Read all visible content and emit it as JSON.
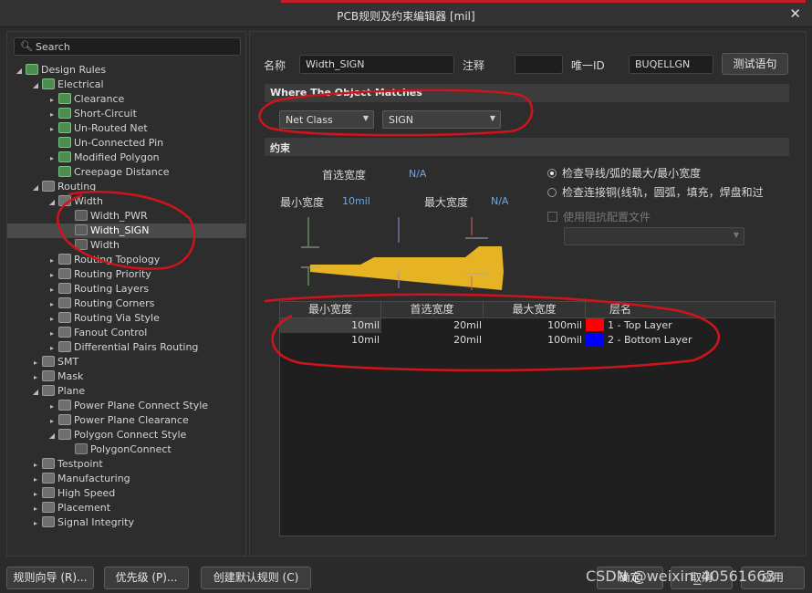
{
  "window": {
    "title": "PCB规则及约束编辑器 [mil]",
    "close": "✕"
  },
  "search": {
    "placeholder": "Search"
  },
  "tree": [
    {
      "label": "Design Rules",
      "level": 0,
      "exp": "◢",
      "icon": "rule"
    },
    {
      "label": "Electrical",
      "level": 1,
      "exp": "◢",
      "icon": "rule"
    },
    {
      "label": "Clearance",
      "level": 2,
      "exp": "▸",
      "icon": "rule"
    },
    {
      "label": "Short-Circuit",
      "level": 2,
      "exp": "▸",
      "icon": "rule"
    },
    {
      "label": "Un-Routed Net",
      "level": 2,
      "exp": "▸",
      "icon": "rule"
    },
    {
      "label": "Un-Connected Pin",
      "level": 2,
      "exp": "",
      "icon": "rule"
    },
    {
      "label": "Modified Polygon",
      "level": 2,
      "exp": "▸",
      "icon": "rule"
    },
    {
      "label": "Creepage Distance",
      "level": 2,
      "exp": "",
      "icon": "rule"
    },
    {
      "label": "Routing",
      "level": 1,
      "exp": "◢",
      "icon": "folder"
    },
    {
      "label": "Width",
      "level": 2,
      "exp": "◢",
      "icon": "folder"
    },
    {
      "label": "Width_PWR",
      "level": 3,
      "exp": "",
      "icon": "sub"
    },
    {
      "label": "Width_SIGN",
      "level": 3,
      "exp": "",
      "icon": "sub",
      "selected": true
    },
    {
      "label": "Width",
      "level": 3,
      "exp": "",
      "icon": "sub"
    },
    {
      "label": "Routing Topology",
      "level": 2,
      "exp": "▸",
      "icon": "folder"
    },
    {
      "label": "Routing Priority",
      "level": 2,
      "exp": "▸",
      "icon": "folder"
    },
    {
      "label": "Routing Layers",
      "level": 2,
      "exp": "▸",
      "icon": "folder"
    },
    {
      "label": "Routing Corners",
      "level": 2,
      "exp": "▸",
      "icon": "folder"
    },
    {
      "label": "Routing Via Style",
      "level": 2,
      "exp": "▸",
      "icon": "folder"
    },
    {
      "label": "Fanout Control",
      "level": 2,
      "exp": "▸",
      "icon": "folder"
    },
    {
      "label": "Differential Pairs Routing",
      "level": 2,
      "exp": "▸",
      "icon": "folder"
    },
    {
      "label": "SMT",
      "level": 1,
      "exp": "▸",
      "icon": "folder"
    },
    {
      "label": "Mask",
      "level": 1,
      "exp": "▸",
      "icon": "folder"
    },
    {
      "label": "Plane",
      "level": 1,
      "exp": "◢",
      "icon": "folder"
    },
    {
      "label": "Power Plane Connect Style",
      "level": 2,
      "exp": "▸",
      "icon": "folder"
    },
    {
      "label": "Power Plane Clearance",
      "level": 2,
      "exp": "▸",
      "icon": "folder"
    },
    {
      "label": "Polygon Connect Style",
      "level": 2,
      "exp": "◢",
      "icon": "folder"
    },
    {
      "label": "PolygonConnect",
      "level": 3,
      "exp": "",
      "icon": "sub"
    },
    {
      "label": "Testpoint",
      "level": 1,
      "exp": "▸",
      "icon": "folder"
    },
    {
      "label": "Manufacturing",
      "level": 1,
      "exp": "▸",
      "icon": "folder"
    },
    {
      "label": "High Speed",
      "level": 1,
      "exp": "▸",
      "icon": "folder"
    },
    {
      "label": "Placement",
      "level": 1,
      "exp": "▸",
      "icon": "folder"
    },
    {
      "label": "Signal Integrity",
      "level": 1,
      "exp": "▸",
      "icon": "folder"
    }
  ],
  "rule": {
    "name_label": "名称",
    "name_value": "Width_SIGN",
    "comment_label": "注释",
    "comment_value": "",
    "uid_label": "唯一ID",
    "uid_value": "BUQELLGN",
    "test_button": "测试语句"
  },
  "where": {
    "title": "Where The Object Matches",
    "type": "Net Class",
    "value": "SIGN"
  },
  "constraints": {
    "title": "约束",
    "preferred_label": "首选宽度",
    "preferred_value": "N/A",
    "min_label": "最小宽度",
    "min_value": "10mil",
    "max_label": "最大宽度",
    "max_value": "N/A",
    "radio1": "检查导线/弧的最大/最小宽度",
    "radio2": "检查连接铜(线轨，圆弧，填充，焊盘和过",
    "impedance": "使用阻抗配置文件"
  },
  "table": {
    "headers": [
      "最小宽度",
      "首选宽度",
      "最大宽度",
      "层名"
    ],
    "rows": [
      {
        "min": "10mil",
        "pref": "20mil",
        "max": "100mil",
        "color": "#ff0000",
        "layer": "1 - Top Layer"
      },
      {
        "min": "10mil",
        "pref": "20mil",
        "max": "100mil",
        "color": "#0000ff",
        "layer": "2 - Bottom Layer"
      }
    ]
  },
  "footer": {
    "wizard": "规则向导 (R)...",
    "priority": "优先级 (P)...",
    "create_default": "创建默认规则 (C)",
    "ok": "确定",
    "cancel": "取消",
    "apply": "应用"
  },
  "watermark": "CSDN @weixin_40561663",
  "colors": {
    "accent": "#6fa7e0",
    "annotation": "#d0141c",
    "track": "#e6b324"
  }
}
